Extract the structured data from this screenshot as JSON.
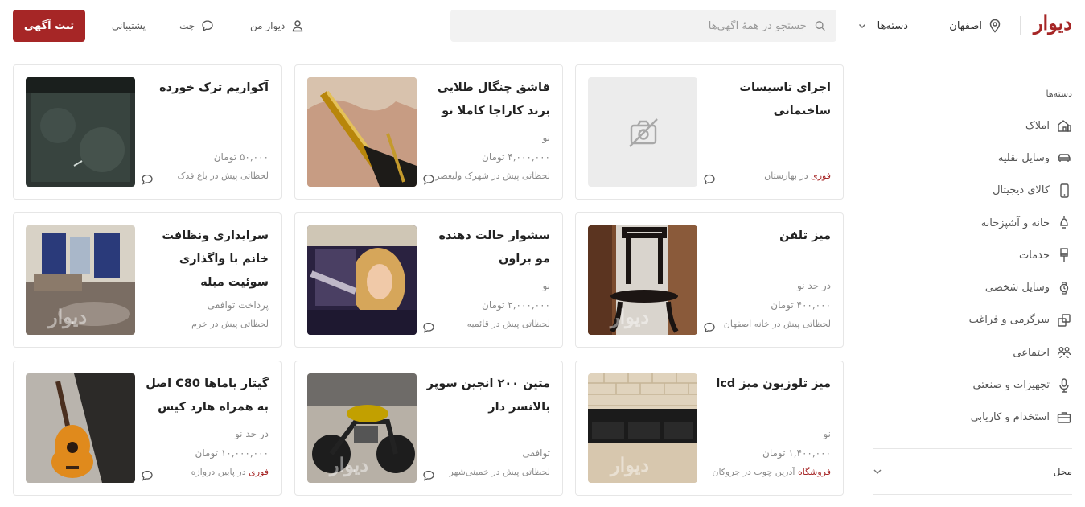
{
  "header": {
    "logo": "دیوار",
    "city": "اصفهان",
    "categories_label": "دسته‌ها",
    "search_placeholder": "جستجو در همهٔ آگهی‌ها",
    "my_divar": "دیوار من",
    "chat": "چت",
    "support": "پشتیبانی",
    "post_ad": "ثبت آگهی"
  },
  "sidebar": {
    "title": "دسته‌ها",
    "items": [
      {
        "label": "املاک",
        "icon": "house-icon"
      },
      {
        "label": "وسایل نقلیه",
        "icon": "car-icon"
      },
      {
        "label": "کالای دیجیتال",
        "icon": "mobile-icon"
      },
      {
        "label": "خانه و آشپزخانه",
        "icon": "lamp-icon"
      },
      {
        "label": "خدمات",
        "icon": "brush-icon"
      },
      {
        "label": "وسایل شخصی",
        "icon": "watch-icon"
      },
      {
        "label": "سرگرمی و فراغت",
        "icon": "puzzle-icon"
      },
      {
        "label": "اجتماعی",
        "icon": "people-icon"
      },
      {
        "label": "تجهیزات و صنعتی",
        "icon": "microphone-icon"
      },
      {
        "label": "استخدام و کاریابی",
        "icon": "briefcase-icon"
      }
    ],
    "location": "محل"
  },
  "cards": [
    {
      "title": "اجرای تاسیسات ساختمانی",
      "line1": "",
      "line2": "",
      "badge": "فوری",
      "location": " در بهارستان",
      "image": "no-image-icon"
    },
    {
      "title": "قاشق چنگال طلایی برند کاراجا کاملا نو",
      "line1": "نو",
      "line2": "۴,۰۰۰,۰۰۰ تومان",
      "badge": "",
      "location": "لحظاتی پیش در شهرک ولیعصر",
      "image": "gold-cutlery-photo"
    },
    {
      "title": "آکواریم ترک خورده",
      "line1": "",
      "line2": "۵۰,۰۰۰ تومان",
      "badge": "",
      "location": "لحظاتی پیش در باغ فدک",
      "image": "aquarium-photo"
    },
    {
      "title": "میز تلفن",
      "line1": "در حد نو",
      "line2": "۴۰۰,۰۰۰ تومان",
      "badge": "",
      "location": "لحظاتی پیش در خانه اصفهان",
      "image": "phone-table-photo"
    },
    {
      "title": "سشوار حالت دهنده مو براون",
      "line1": "نو",
      "line2": "۲,۰۰۰,۰۰۰ تومان",
      "badge": "",
      "location": "لحظاتی پیش در قائمیه",
      "image": "hair-dryer-photo"
    },
    {
      "title": "سرایداری ونظافت خانم با واگذاری سوئیت مبله",
      "line1": "",
      "line2": "پرداخت توافقی",
      "badge": "",
      "location": "لحظاتی پیش در خرم",
      "image": "room-photo"
    },
    {
      "title": "میز تلوزیون میز lcd",
      "line1": "نو",
      "line2": "۱,۴۰۰,۰۰۰ تومان",
      "badge": "فروشگاه",
      "location": " آدرین چوب در جروکان",
      "image": "tv-stand-photo"
    },
    {
      "title": "متین ۲۰۰ انجین سوپر بالانسر دار",
      "line1": "",
      "line2": "توافقی",
      "badge": "",
      "location": "لحظاتی پیش در خمینی‌شهر",
      "image": "motorcycle-photo"
    },
    {
      "title": "گیتار یاماها C80 اصل به همراه هارد کیس",
      "line1": "در حد نو",
      "line2": "۱۰,۰۰۰,۰۰۰ تومان",
      "badge": "فوری",
      "location": " در پایین دروازه",
      "image": "guitar-photo"
    }
  ],
  "watermark": "دیوار",
  "colors": {
    "brand": "#a62626",
    "border": "#e6e6e6"
  }
}
